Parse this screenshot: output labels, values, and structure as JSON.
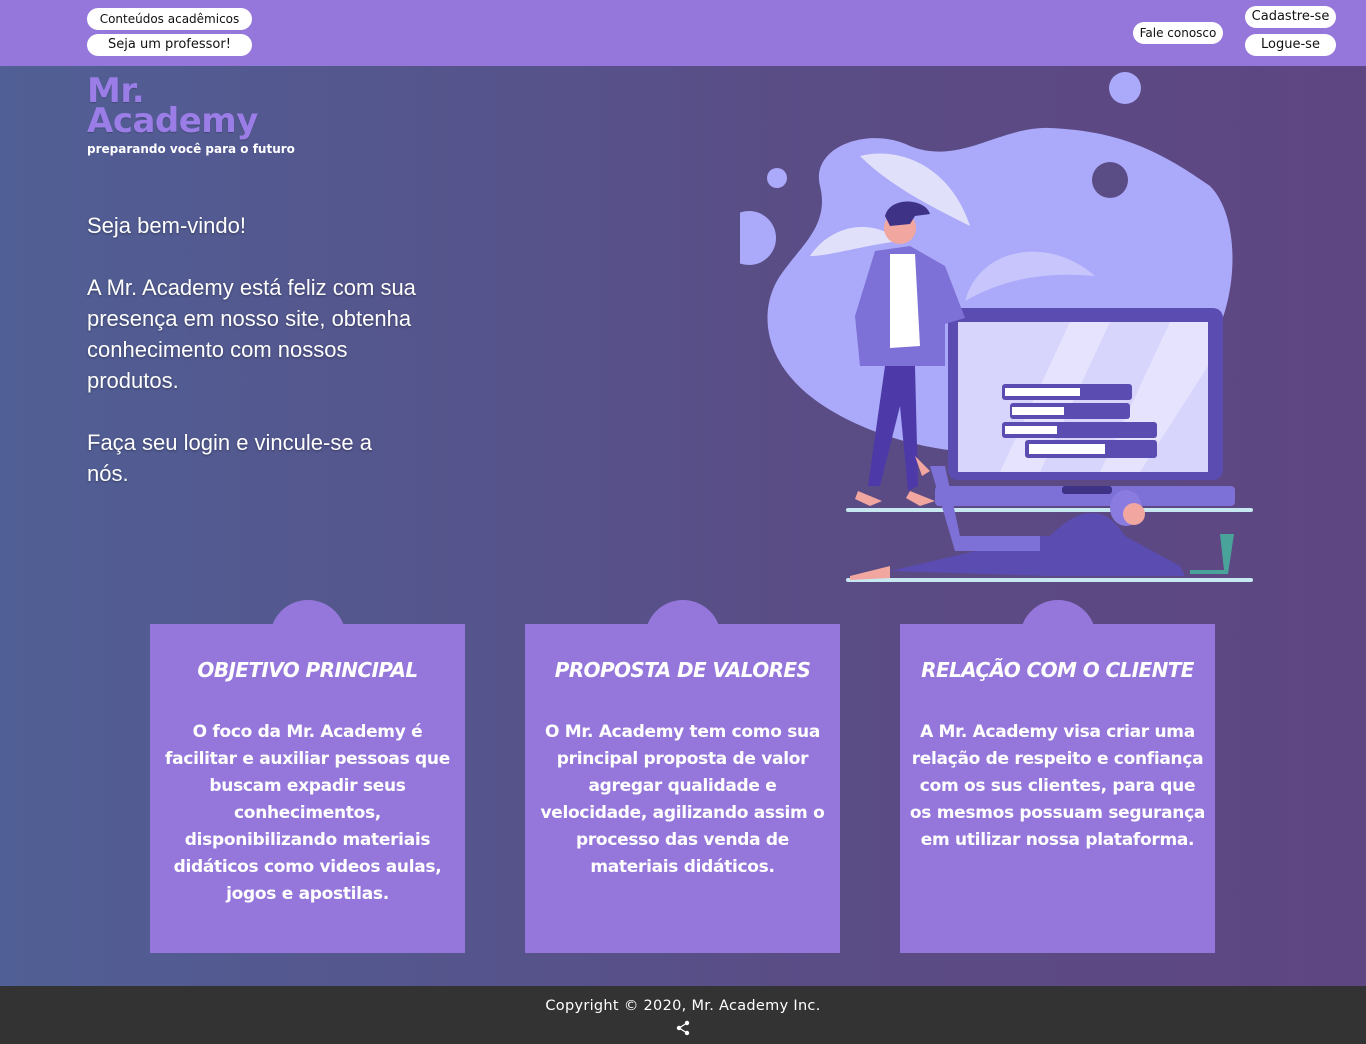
{
  "nav": {
    "conteudos_label": "Conteúdos acadêmicos",
    "professor_label": "Seja um professor!",
    "fale_label": "Fale conosco",
    "cadastre_label": "Cadastre-se",
    "logue_label": "Logue-se"
  },
  "logo": {
    "line1": "Mr.",
    "line2": "Academy",
    "tagline": "preparando você para o futuro"
  },
  "welcome": {
    "greeting": "Seja bem-vindo!",
    "paragraph1": "A Mr. Academy está feliz com sua presença em nosso site, obtenha conhecimento com nossos produtos.",
    "paragraph2": "Faça seu login e vincule-se a nós."
  },
  "cards": [
    {
      "title": "OBJETIVO PRINCIPAL",
      "body": "O foco da Mr. Academy é facilitar e auxiliar  pessoas que buscam expadir seus conhecimentos, disponibilizando materiais didáticos como videos aulas, jogos e apostilas."
    },
    {
      "title": "PROPOSTA DE VALORES",
      "body": "O Mr. Academy tem como sua principal proposta de valor agregar qualidade e velocidade, agilizando assim o processo das venda de materiais didáticos."
    },
    {
      "title": "RELAÇÃO COM O CLIENTE",
      "body": "A Mr. Academy visa criar uma relação de respeito e confiança com os sus clientes, para que os mesmos possuam segurança em utilizar nossa plataforma."
    }
  ],
  "footer": {
    "copyright": "Copyright © 2020, Mr. Academy Inc.",
    "share_icon": "share-icon"
  },
  "colors": {
    "accent": "#9577db",
    "footer": "#333333"
  }
}
